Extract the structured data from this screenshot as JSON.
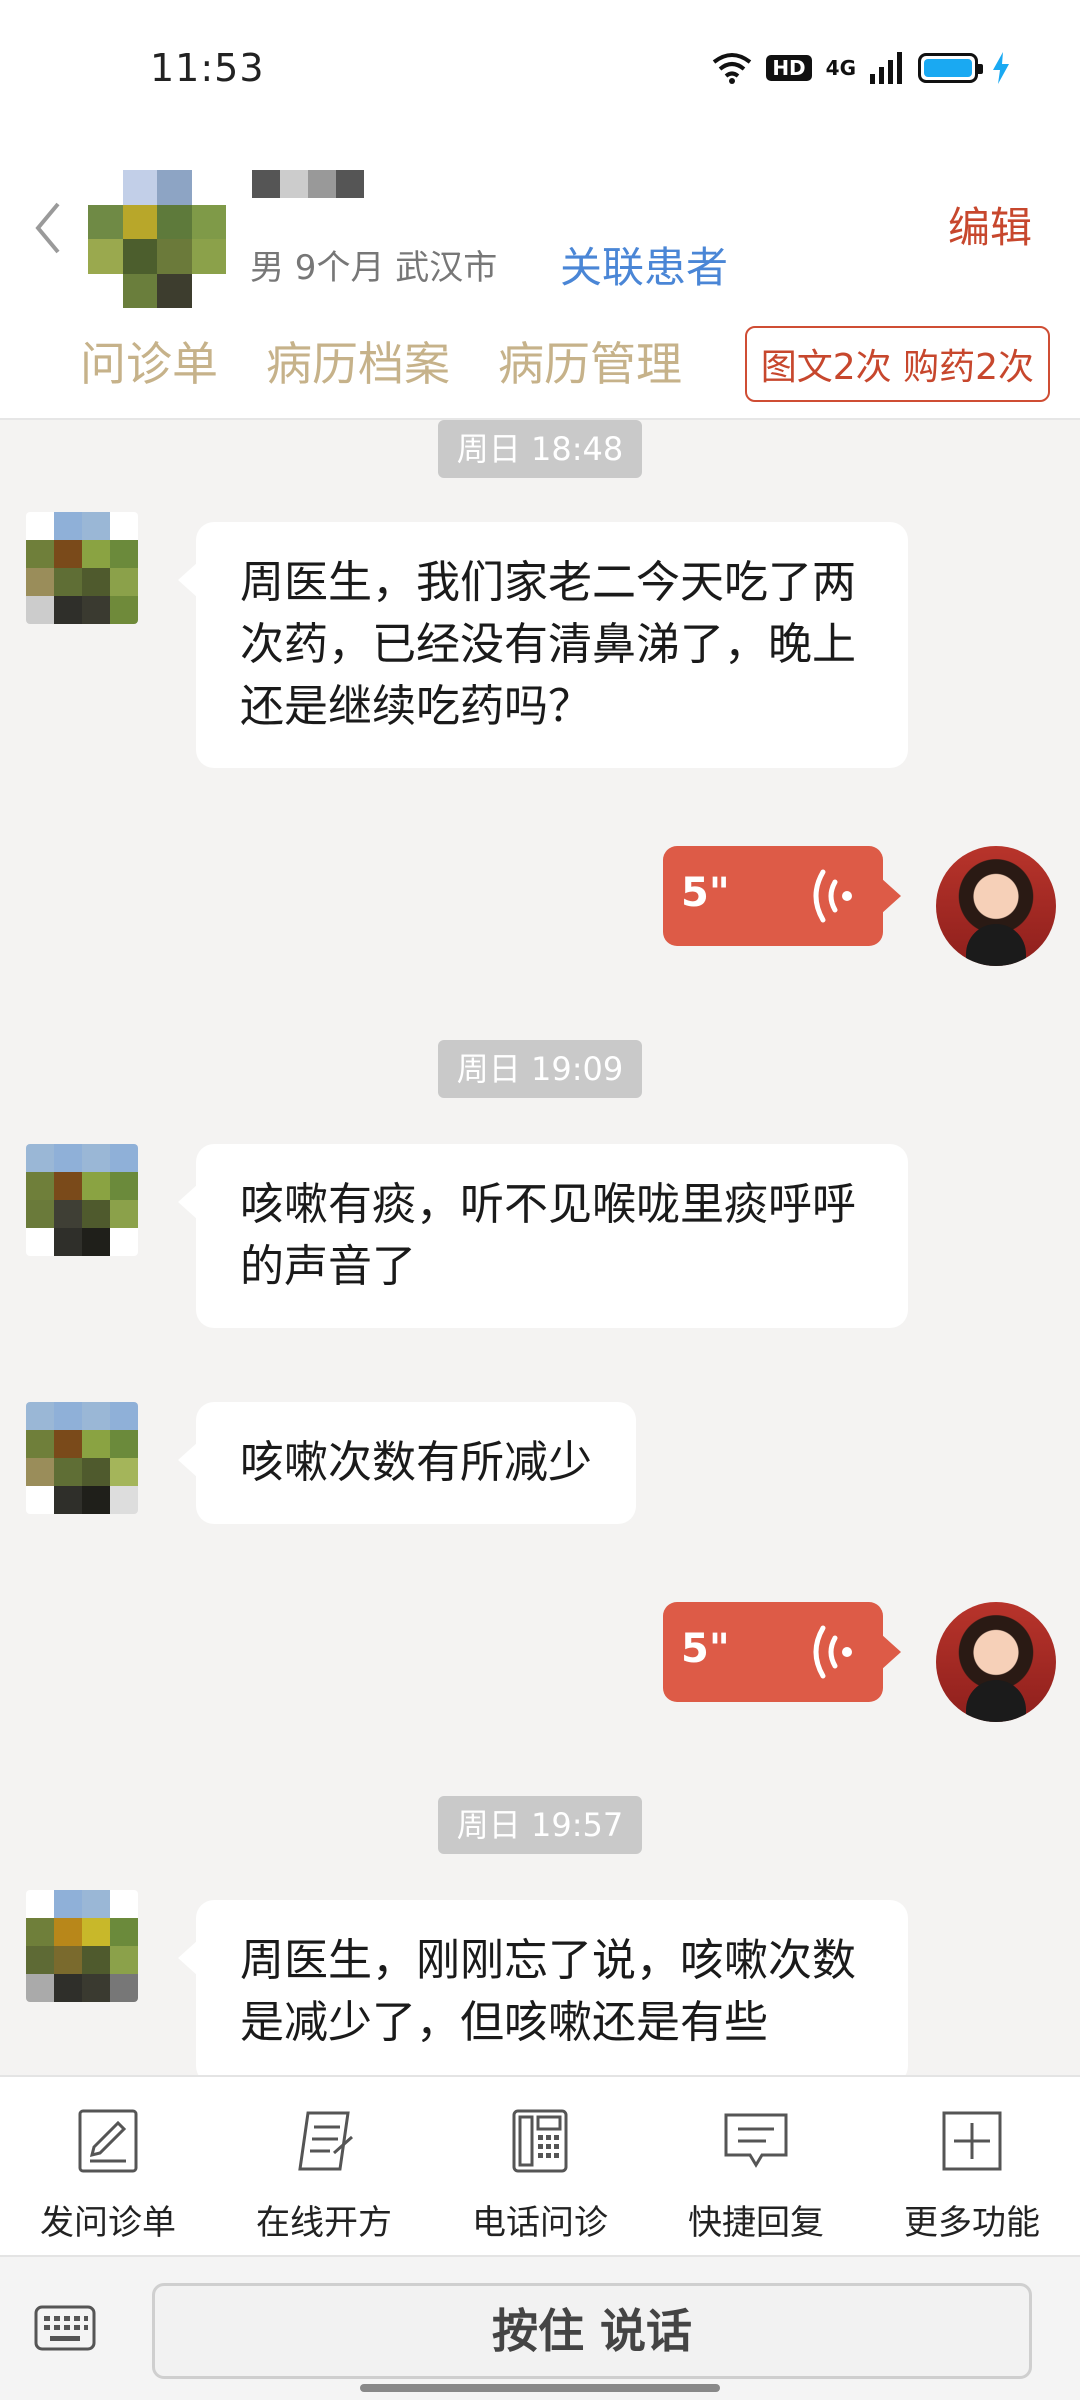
{
  "status_bar": {
    "time": "11:53",
    "hd_label": "HD",
    "network_label": "4G"
  },
  "header": {
    "patient_info": "男 9个月  武汉市",
    "link_patient": "关联患者",
    "edit": "编辑",
    "tabs": [
      "问诊单",
      "病历档案",
      "病历管理"
    ],
    "usage_badge": "图文2次 购药2次"
  },
  "messages": [
    {
      "type": "time",
      "text": "周日 18:48"
    },
    {
      "type": "patient_text",
      "text": "周医生，我们家老二今天吃了两次药，已经没有清鼻涕了，晚上还是继续吃药吗？"
    },
    {
      "type": "doctor_voice",
      "duration": "5\""
    },
    {
      "type": "time",
      "text": "周日 19:09"
    },
    {
      "type": "patient_text",
      "text": "咳嗽有痰，听不见喉咙里痰呼呼的声音了"
    },
    {
      "type": "patient_text",
      "text": "咳嗽次数有所减少"
    },
    {
      "type": "doctor_voice",
      "duration": "5\""
    },
    {
      "type": "time",
      "text": "周日 19:57"
    },
    {
      "type": "patient_text",
      "text": "周医生，刚刚忘了说，咳嗽次数是减少了，但咳嗽还是有些"
    }
  ],
  "toolbar": {
    "items": [
      {
        "label": "发问诊单",
        "icon": "form-edit-icon"
      },
      {
        "label": "在线开方",
        "icon": "prescription-icon"
      },
      {
        "label": "电话问诊",
        "icon": "phone-icon"
      },
      {
        "label": "快捷回复",
        "icon": "quick-reply-icon"
      },
      {
        "label": "更多功能",
        "icon": "plus-box-icon"
      }
    ]
  },
  "input_bar": {
    "hold_to_talk": "按住 说话",
    "keyboard_icon": "keyboard-icon"
  },
  "colors": {
    "accent": "#dd5b47",
    "tab": "#c6b28a",
    "link": "#4a86d6",
    "edit": "#c7472d"
  }
}
